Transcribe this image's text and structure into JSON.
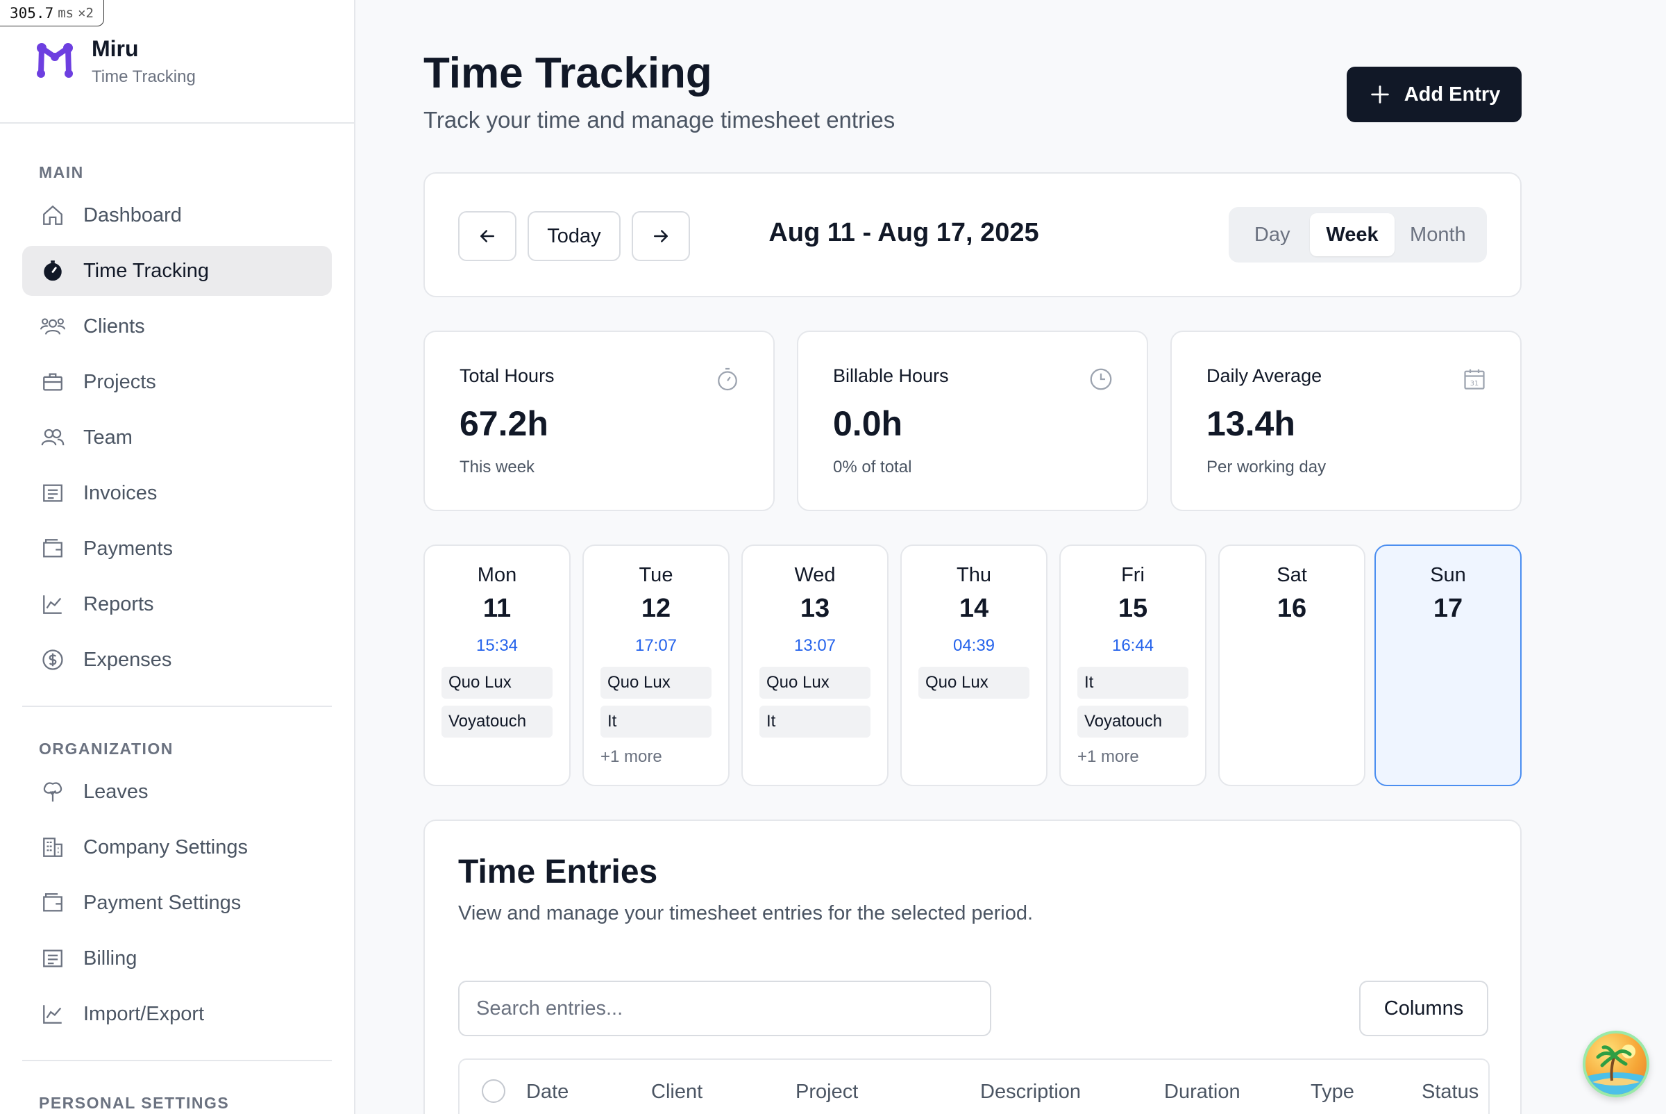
{
  "perf": {
    "value": "305.7",
    "unit": "ms",
    "mult": "×2"
  },
  "brand": {
    "name": "Miru",
    "subtitle": "Time Tracking"
  },
  "sidebar": {
    "main_heading": "MAIN",
    "main_items": [
      {
        "label": "Dashboard",
        "icon": "home-icon"
      },
      {
        "label": "Time Tracking",
        "icon": "stopwatch-icon",
        "active": true
      },
      {
        "label": "Clients",
        "icon": "clients-icon"
      },
      {
        "label": "Projects",
        "icon": "briefcase-icon"
      },
      {
        "label": "Team",
        "icon": "team-icon"
      },
      {
        "label": "Invoices",
        "icon": "invoice-icon"
      },
      {
        "label": "Payments",
        "icon": "wallet-icon"
      },
      {
        "label": "Reports",
        "icon": "chart-line-icon"
      },
      {
        "label": "Expenses",
        "icon": "dollar-circle-icon"
      }
    ],
    "org_heading": "ORGANIZATION",
    "org_items": [
      {
        "label": "Leaves",
        "icon": "tree-icon"
      },
      {
        "label": "Company Settings",
        "icon": "building-icon"
      },
      {
        "label": "Payment Settings",
        "icon": "wallet-icon"
      },
      {
        "label": "Billing",
        "icon": "invoice-icon"
      },
      {
        "label": "Import/Export",
        "icon": "chart-line-icon"
      }
    ],
    "personal_heading": "PERSONAL SETTINGS"
  },
  "header": {
    "title": "Time Tracking",
    "subtitle": "Track your time and manage timesheet entries",
    "add_label": "Add Entry"
  },
  "period": {
    "today_label": "Today",
    "range": "Aug 11 - Aug 17, 2025",
    "views": [
      "Day",
      "Week",
      "Month"
    ],
    "selected_view": "Week"
  },
  "stats": [
    {
      "label": "Total Hours",
      "value": "67.2h",
      "note": "This week",
      "icon": "stopwatch-icon"
    },
    {
      "label": "Billable Hours",
      "value": "0.0h",
      "note": "0% of total",
      "icon": "clock-icon"
    },
    {
      "label": "Daily Average",
      "value": "13.4h",
      "note": "Per working day",
      "icon": "calendar-icon"
    }
  ],
  "days": [
    {
      "name": "Mon",
      "date": "11",
      "time": "15:34",
      "chips": [
        "Quo Lux",
        "Voyatouch"
      ],
      "more": ""
    },
    {
      "name": "Tue",
      "date": "12",
      "time": "17:07",
      "chips": [
        "Quo Lux",
        "It"
      ],
      "more": "+1 more"
    },
    {
      "name": "Wed",
      "date": "13",
      "time": "13:07",
      "chips": [
        "Quo Lux",
        "It"
      ],
      "more": ""
    },
    {
      "name": "Thu",
      "date": "14",
      "time": "04:39",
      "chips": [
        "Quo Lux"
      ],
      "more": ""
    },
    {
      "name": "Fri",
      "date": "15",
      "time": "16:44",
      "chips": [
        "It",
        "Voyatouch"
      ],
      "more": "+1 more"
    },
    {
      "name": "Sat",
      "date": "16",
      "time": "",
      "chips": [],
      "more": ""
    },
    {
      "name": "Sun",
      "date": "17",
      "time": "",
      "chips": [],
      "more": "",
      "today": true
    }
  ],
  "entries": {
    "title": "Time Entries",
    "subtitle": "View and manage your timesheet entries for the selected period.",
    "search_placeholder": "Search entries...",
    "columns_label": "Columns",
    "headers": [
      "Date",
      "Client",
      "Project",
      "Description",
      "Duration",
      "Type",
      "Status"
    ]
  },
  "colors": {
    "accent": "#111827",
    "brand": "#6d3fe0",
    "time": "#2563eb",
    "today_bg": "#eff5ff",
    "today_border": "#4b8ef0"
  }
}
